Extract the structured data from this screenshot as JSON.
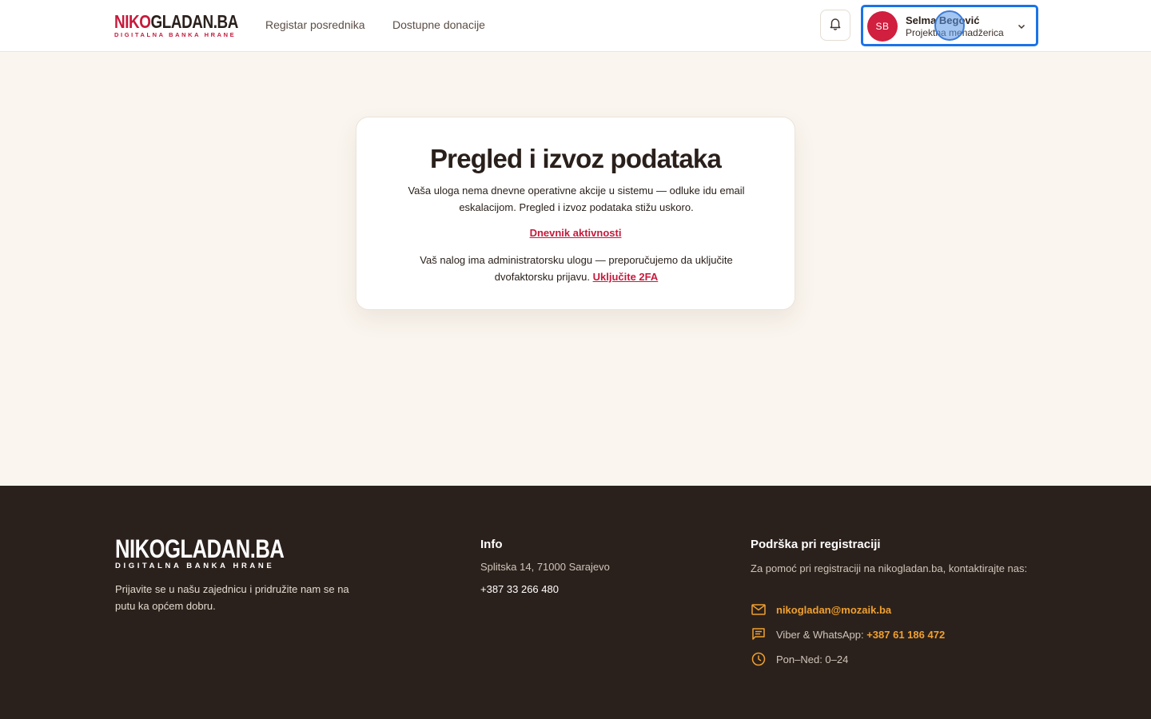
{
  "header": {
    "logo": {
      "part1": "NIKO",
      "part2": "GLADAN.BA",
      "tagline": "DIGITALNA BANKA HRANE"
    },
    "nav": [
      "Registar posrednika",
      "Dostupne donacije"
    ],
    "user": {
      "initials": "SB",
      "name": "Selma Begović",
      "role": "Projektna menadžerica"
    }
  },
  "card": {
    "title": "Pregled i izvoz podataka",
    "text": "Vaša uloga nema dnevne operativne akcije u sistemu — odluke idu email eskalacijom. Pregled i izvoz podataka stižu uskoro.",
    "link": "Dnevnik aktivnosti",
    "note": "Vaš nalog ima administratorsku ulogu — preporučujemo da uključite dvofaktorsku prijavu.",
    "note_link": "Uključite 2FA"
  },
  "footer": {
    "logo": {
      "word": "NIKOGLADAN.BA",
      "tagline": "DIGITALNA BANKA HRANE"
    },
    "about": "Prijavite se u našu zajednicu i pridružite nam se na putu ka općem dobru.",
    "info": {
      "title": "Info",
      "address": "Splitska 14, 71000 Sarajevo",
      "phone": "+387 33 266 480"
    },
    "support": {
      "title": "Podrška pri registraciji",
      "text": "Za pomoć pri registraciji na nikogladan.ba, kontaktirajte nas:",
      "email": "nikogladan@mozaik.ba",
      "viber_label": "Viber & WhatsApp:",
      "viber_phone": "+387 61 186 472",
      "hours": "Pon–Ned: 0–24"
    }
  },
  "colors": {
    "brand": "#c8193c",
    "accent": "#f0a030",
    "focus": "#1a73e8",
    "footer_bg": "#2b211c",
    "page_bg": "#faf5ee"
  },
  "icons": [
    "bell-icon",
    "chevron-down-icon",
    "mail-icon",
    "chat-icon",
    "clock-icon"
  ]
}
